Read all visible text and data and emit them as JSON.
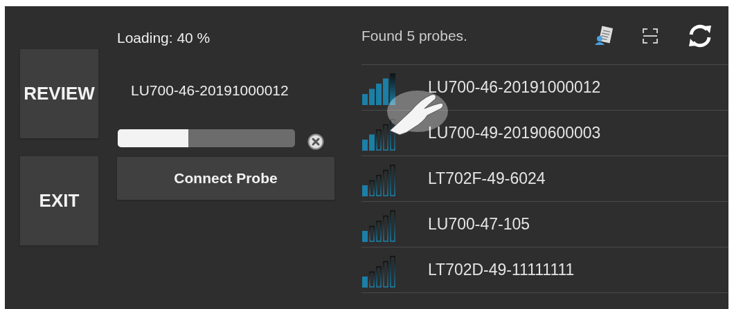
{
  "side_buttons": [
    "REVIEW",
    "EXIT"
  ],
  "loading": {
    "label": "Loading: 40 %",
    "probe": "LU700-46-20191000012",
    "level": 0.4
  },
  "connect_button": "Connect Probe",
  "found": "Found 5 probes.",
  "probes": [
    {
      "name": "LU700-46-20191000012",
      "kind": "full"
    },
    {
      "name": "LU700-49-20190600003",
      "kind": "weak"
    },
    {
      "name": "LT702F-49-6024",
      "kind": "minimal"
    },
    {
      "name": "LU700-47-105",
      "kind": "minimal"
    },
    {
      "name": "LT702D-49-11111111",
      "kind": "minimal"
    }
  ]
}
